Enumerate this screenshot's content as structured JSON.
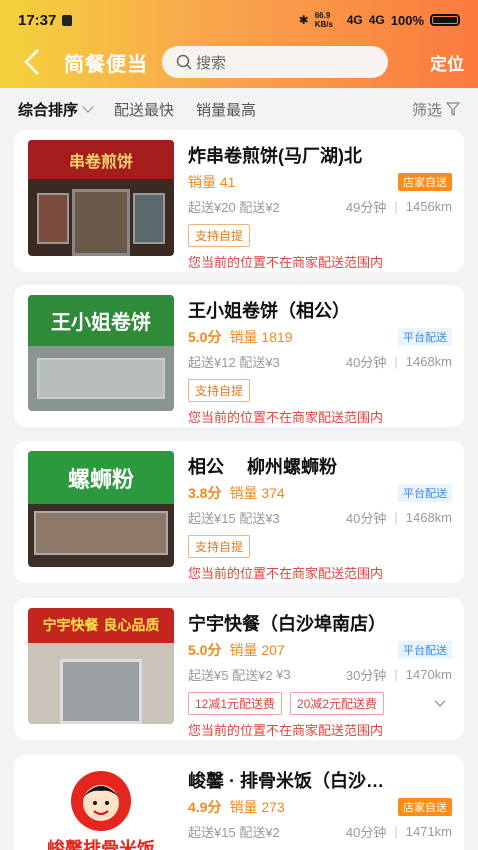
{
  "status": {
    "time": "17:37",
    "net_speed": "66.9 KB/s",
    "signal1": "4G",
    "signal2": "4G",
    "battery": "100%"
  },
  "nav": {
    "title": "简餐便当",
    "search_placeholder": "搜索",
    "locate": "定位"
  },
  "sort": {
    "items": [
      "综合排序",
      "配送最快",
      "销量最高"
    ],
    "filter": "筛选"
  },
  "shops": [
    {
      "name": "炸串卷煎饼(马厂湖)北",
      "score": "",
      "sales": "销量 41",
      "badge": "店家自送",
      "badge_type": "self",
      "min_order": "起送¥20",
      "delivery_fee": "配送¥2",
      "delivery_fee_alt": "",
      "time": "49分钟",
      "distance": "1456km",
      "tags": [
        "支持自提"
      ],
      "warning": "您当前的位置不在商家配送范围内",
      "sign_text": "串卷煎饼"
    },
    {
      "name": "王小姐卷饼（相公）",
      "score": "5.0分",
      "sales": "销量 1819",
      "badge": "平台配送",
      "badge_type": "plat",
      "min_order": "起送¥12",
      "delivery_fee": "配送¥3",
      "delivery_fee_alt": "",
      "time": "40分钟",
      "distance": "1468km",
      "tags": [
        "支持自提"
      ],
      "warning": "您当前的位置不在商家配送范围内",
      "sign_text": "王小姐卷饼"
    },
    {
      "name": "相公　 柳州螺蛳粉",
      "score": "3.8分",
      "sales": "销量 374",
      "badge": "平台配送",
      "badge_type": "plat",
      "min_order": "起送¥15",
      "delivery_fee": "配送¥3",
      "delivery_fee_alt": "",
      "time": "40分钟",
      "distance": "1468km",
      "tags": [
        "支持自提"
      ],
      "warning": "您当前的位置不在商家配送范围内",
      "sign_text": "螺蛳粉"
    },
    {
      "name": "宁宇快餐（白沙埠南店）",
      "score": "5.0分",
      "sales": "销量 207",
      "badge": "平台配送",
      "badge_type": "plat",
      "min_order": "起送¥5",
      "delivery_fee": "配送¥2",
      "delivery_fee_alt": "¥3",
      "time": "30分钟",
      "distance": "1470km",
      "tags": [
        "12减1元配送费",
        "20减2元配送费"
      ],
      "warning": "您当前的位置不在商家配送范围内",
      "sign_text": "宁宇快餐 良心品质"
    },
    {
      "name": "峻馨 · 排骨米饭（白沙…",
      "score": "4.9分",
      "sales": "销量 273",
      "badge": "店家自送",
      "badge_type": "self",
      "min_order": "起送¥15",
      "delivery_fee": "配送¥2",
      "delivery_fee_alt": "",
      "time": "40分钟",
      "distance": "1471km",
      "tags": [],
      "warning": "",
      "sign_text": "峻馨排骨米饭"
    }
  ],
  "colors": {
    "accent": "#ef8a1d",
    "warning": "#e0443e",
    "header_start": "#f4d23c",
    "header_end": "#fb7a3e"
  }
}
